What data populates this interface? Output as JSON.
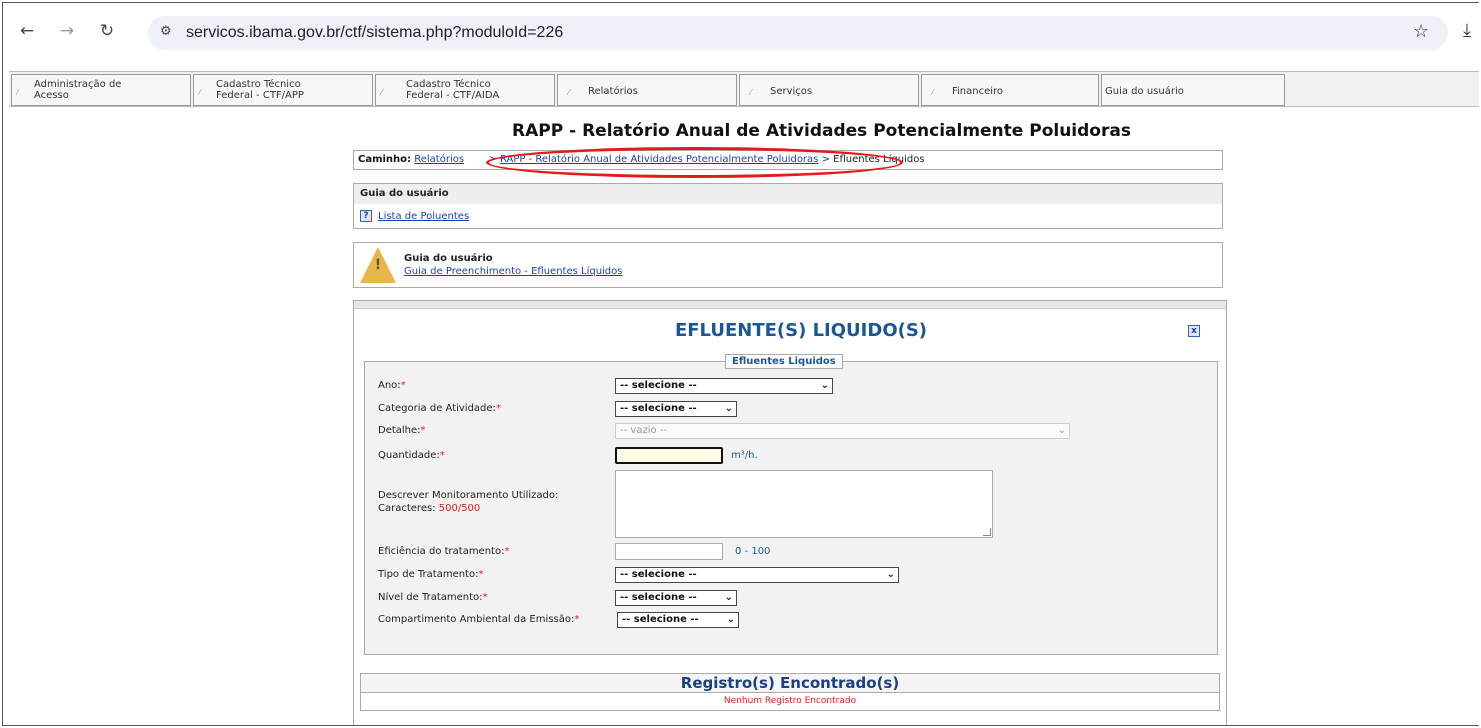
{
  "browser": {
    "url": "servicos.ibama.gov.br/ctf/sistema.php?moduloId=226"
  },
  "menu": [
    {
      "label": "Administração de\nAcesso"
    },
    {
      "label": "Cadastro Técnico\nFederal - CTF/APP"
    },
    {
      "label": "Cadastro Técnico\nFederal - CTF/AIDA"
    },
    {
      "label": "Relatórios"
    },
    {
      "label": "Serviços"
    },
    {
      "label": "Financeiro"
    },
    {
      "label": "Guia do usuário"
    }
  ],
  "page_title": "RAPP - Relatório Anual de Atividades Potencialmente Poluidoras",
  "breadcrumb": {
    "prefix": "Caminho:",
    "level1": "Relatórios",
    "sep": ">",
    "level2": "RAPP - Relatório Anual de Atividades Potencialmente Poluidoras",
    "current": "Efluentes Líquidos"
  },
  "guide1": {
    "header": "Guia do usuário",
    "link": "Lista de Poluentes"
  },
  "guide2": {
    "title": "Guia do usuário",
    "link": "Guia de Preenchimento - Efluentes Líquidos"
  },
  "panel": {
    "title": "EFLUENTE(S) LIQUIDO(S)",
    "legend": "Efluentes Liquidos",
    "req": "*",
    "fields": {
      "ano": {
        "label": "Ano:",
        "value": "-- selecione --"
      },
      "categoria": {
        "label": "Categoria de Atividade:",
        "value": "-- selecione --"
      },
      "detalhe": {
        "label": "Detalhe:",
        "value": "-- vazio --"
      },
      "quantidade": {
        "label": "Quantidade:",
        "unit": "m³/h."
      },
      "monitoramento": {
        "label": "Descrever Monitoramento Utilizado:",
        "chars_label": "Caracteres:",
        "chars_value": "500/500"
      },
      "eficiencia": {
        "label": "Eficiência do tratamento:",
        "unit": "0 - 100"
      },
      "tipo": {
        "label": "Tipo de Tratamento:",
        "value": "-- selecione --"
      },
      "nivel": {
        "label": "Nível de Tratamento:",
        "value": "-- selecione --"
      },
      "compartimento": {
        "label": "Compartimento Ambiental da Emissão:",
        "value": "-- selecione --"
      }
    }
  },
  "results": {
    "header": "Registro(s) Encontrado(s)",
    "message": "Nenhum Registro Encontrado"
  }
}
